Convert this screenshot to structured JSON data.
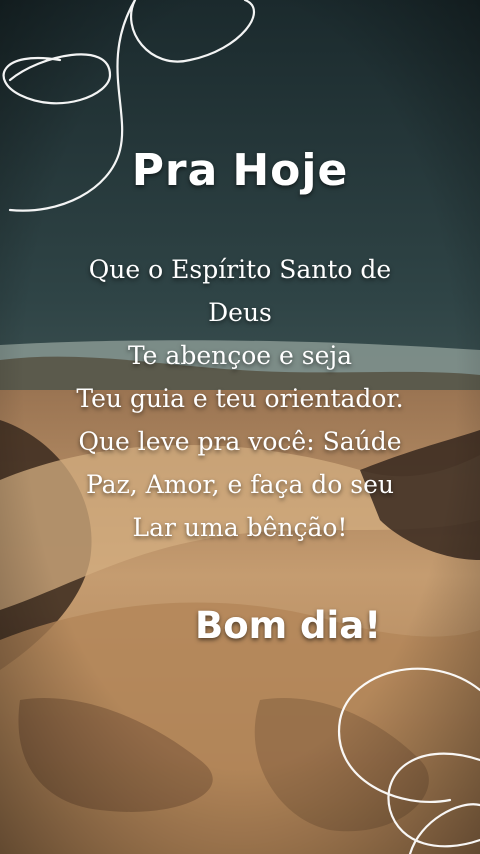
{
  "scene": {
    "colors": {
      "sky_top": "#1e2f32",
      "sky_mid": "#3c5456",
      "water": "#8e9c96",
      "dune_light": "#c59c70",
      "dune_mid": "#a67a50",
      "dune_dark": "#3b2a1e"
    },
    "decorations": [
      "swirl-line-top-left",
      "swirl-line-bottom-right"
    ]
  },
  "title": {
    "word1": "Pra",
    "word2": "Hoje"
  },
  "message": {
    "lines": [
      "Que o Espírito Santo de",
      "Deus",
      "Te abençoe  e seja",
      "Teu guia e teu orientador.",
      "Que leve pra você: Saúde",
      "Paz, Amor, e faça do seu",
      "Lar uma bênção!"
    ]
  },
  "greeting": "Bom dia!"
}
